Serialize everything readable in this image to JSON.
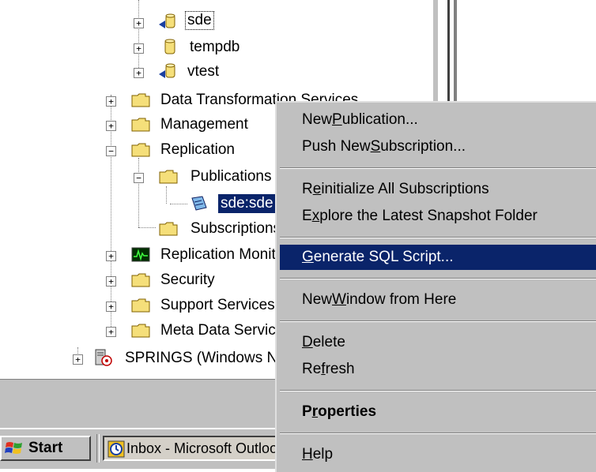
{
  "tree": {
    "items": [
      {
        "label": "sde"
      },
      {
        "label": "tempdb"
      },
      {
        "label": "vtest"
      },
      {
        "label": "Data Transformation Services"
      },
      {
        "label": "Management"
      },
      {
        "label": "Replication"
      },
      {
        "label": "Publications"
      },
      {
        "label": "sde:sde"
      },
      {
        "label": "Subscriptions"
      },
      {
        "label": "Replication Monitor"
      },
      {
        "label": "Security"
      },
      {
        "label": "Support Services"
      },
      {
        "label": "Meta Data Services"
      },
      {
        "label": "SPRINGS (Windows NT)"
      }
    ]
  },
  "context_menu": {
    "items": [
      {
        "pre": "New ",
        "ul": "P",
        "post": "ublication..."
      },
      {
        "pre": "Push New ",
        "ul": "S",
        "post": "ubscription..."
      },
      {
        "pre": "R",
        "ul": "e",
        "post": "initialize All Subscriptions"
      },
      {
        "pre": "E",
        "ul": "x",
        "post": "plore the Latest Snapshot Folder"
      },
      {
        "pre": "",
        "ul": "G",
        "post": "enerate SQL Script..."
      },
      {
        "pre": "New ",
        "ul": "W",
        "post": "indow from Here"
      },
      {
        "pre": "",
        "ul": "D",
        "post": "elete"
      },
      {
        "pre": "Re",
        "ul": "f",
        "post": "resh"
      },
      {
        "pre": "P",
        "ul": "r",
        "post": "operties"
      },
      {
        "pre": "",
        "ul": "H",
        "post": "elp"
      }
    ]
  },
  "taskbar": {
    "start_label": "Start",
    "inbox_label": "Inbox - Microsoft Outlook"
  },
  "colors": {
    "menu_bg": "#c0c0c0",
    "highlight": "#0a246a",
    "folder": "#f5df7a"
  }
}
